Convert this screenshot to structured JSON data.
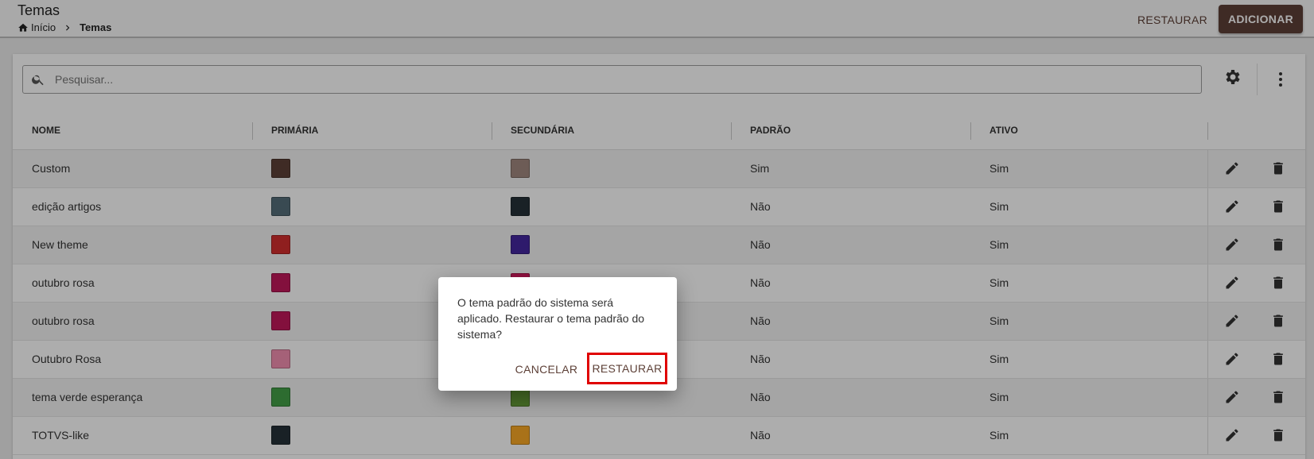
{
  "header": {
    "title": "Temas",
    "breadcrumb": {
      "home": "Início",
      "current": "Temas"
    },
    "restore_label": "RESTAURAR",
    "add_label": "ADICIONAR"
  },
  "search": {
    "placeholder": "Pesquisar..."
  },
  "table": {
    "columns": [
      "NOME",
      "PRIMÁRIA",
      "SECUNDÁRIA",
      "PADRÃO",
      "ATIVO"
    ],
    "rows": [
      {
        "name": "Custom",
        "primary": "#5d4037",
        "secondary": "#a1887f",
        "default": "Sim",
        "active": "Sim"
      },
      {
        "name": "edição artigos",
        "primary": "#546e7a",
        "secondary": "#263238",
        "default": "Não",
        "active": "Sim"
      },
      {
        "name": "New theme",
        "primary": "#d32f2f",
        "secondary": "#4527a0",
        "default": "Não",
        "active": "Sim"
      },
      {
        "name": "outubro rosa",
        "primary": "#c2185b",
        "secondary": "#d81b60",
        "default": "Não",
        "active": "Sim"
      },
      {
        "name": "outubro rosa",
        "primary": "#c2185b",
        "secondary": "#ad1457",
        "default": "Não",
        "active": "Sim"
      },
      {
        "name": "Outubro Rosa",
        "primary": "#f48fb1",
        "secondary": "#ec407a",
        "default": "Não",
        "active": "Sim"
      },
      {
        "name": "tema verde esperança",
        "primary": "#43a047",
        "secondary": "#689f38",
        "default": "Não",
        "active": "Sim"
      },
      {
        "name": "TOTVS-like",
        "primary": "#263238",
        "secondary": "#f9a825",
        "default": "Não",
        "active": "Sim"
      }
    ]
  },
  "dialog": {
    "message": "O tema padrão do sistema será aplicado. Restaurar o tema padrão do sistema?",
    "cancel_label": "CANCELAR",
    "confirm_label": "RESTAURAR"
  },
  "colors": {
    "brand": "#5d4037",
    "highlight": "#e00000"
  },
  "icons": [
    "home-icon",
    "chevron-right-icon",
    "search-icon",
    "gear-icon",
    "more-vert-icon",
    "edit-icon",
    "delete-icon"
  ]
}
